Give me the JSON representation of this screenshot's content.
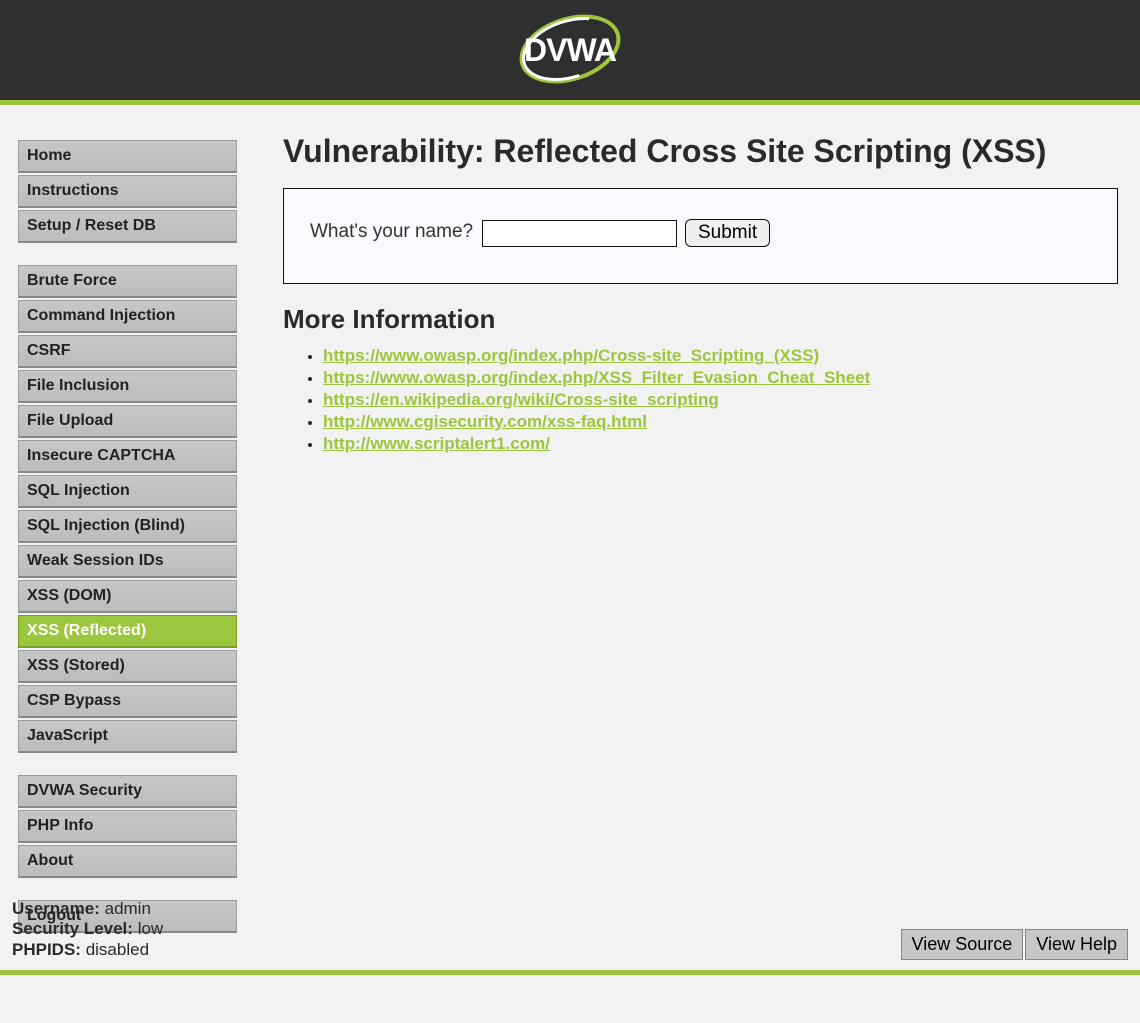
{
  "header": {
    "logo_text": "DVWA"
  },
  "sidebar": {
    "groups": [
      {
        "items": [
          {
            "id": "home",
            "label": "Home",
            "active": false
          },
          {
            "id": "instructions",
            "label": "Instructions",
            "active": false
          },
          {
            "id": "setup",
            "label": "Setup / Reset DB",
            "active": false
          }
        ]
      },
      {
        "items": [
          {
            "id": "brute-force",
            "label": "Brute Force",
            "active": false
          },
          {
            "id": "command-injection",
            "label": "Command Injection",
            "active": false
          },
          {
            "id": "csrf",
            "label": "CSRF",
            "active": false
          },
          {
            "id": "file-inclusion",
            "label": "File Inclusion",
            "active": false
          },
          {
            "id": "file-upload",
            "label": "File Upload",
            "active": false
          },
          {
            "id": "insecure-captcha",
            "label": "Insecure CAPTCHA",
            "active": false
          },
          {
            "id": "sql-injection",
            "label": "SQL Injection",
            "active": false
          },
          {
            "id": "sql-injection-blind",
            "label": "SQL Injection (Blind)",
            "active": false
          },
          {
            "id": "weak-session-ids",
            "label": "Weak Session IDs",
            "active": false
          },
          {
            "id": "xss-dom",
            "label": "XSS (DOM)",
            "active": false
          },
          {
            "id": "xss-reflected",
            "label": "XSS (Reflected)",
            "active": true
          },
          {
            "id": "xss-stored",
            "label": "XSS (Stored)",
            "active": false
          },
          {
            "id": "csp-bypass",
            "label": "CSP Bypass",
            "active": false
          },
          {
            "id": "javascript",
            "label": "JavaScript",
            "active": false
          }
        ]
      },
      {
        "items": [
          {
            "id": "dvwa-security",
            "label": "DVWA Security",
            "active": false
          },
          {
            "id": "php-info",
            "label": "PHP Info",
            "active": false
          },
          {
            "id": "about",
            "label": "About",
            "active": false
          }
        ]
      },
      {
        "items": [
          {
            "id": "logout",
            "label": "Logout",
            "active": false
          }
        ]
      }
    ]
  },
  "main": {
    "title": "Vulnerability: Reflected Cross Site Scripting (XSS)",
    "form": {
      "prompt": "What's your name?",
      "input_value": "",
      "input_placeholder": "",
      "submit_label": "Submit"
    },
    "more_info_heading": "More Information",
    "links": [
      "https://www.owasp.org/index.php/Cross-site_Scripting_(XSS)",
      "https://www.owasp.org/index.php/XSS_Filter_Evasion_Cheat_Sheet",
      "https://en.wikipedia.org/wiki/Cross-site_scripting",
      "http://www.cgisecurity.com/xss-faq.html",
      "http://www.scriptalert1.com/"
    ]
  },
  "footer": {
    "status": {
      "username_label": "Username:",
      "username_value": "admin",
      "security_label": "Security Level:",
      "security_value": "low",
      "phpids_label": "PHPIDS:",
      "phpids_value": "disabled"
    },
    "buttons": {
      "view_source": "View Source",
      "view_help": "View Help"
    }
  }
}
